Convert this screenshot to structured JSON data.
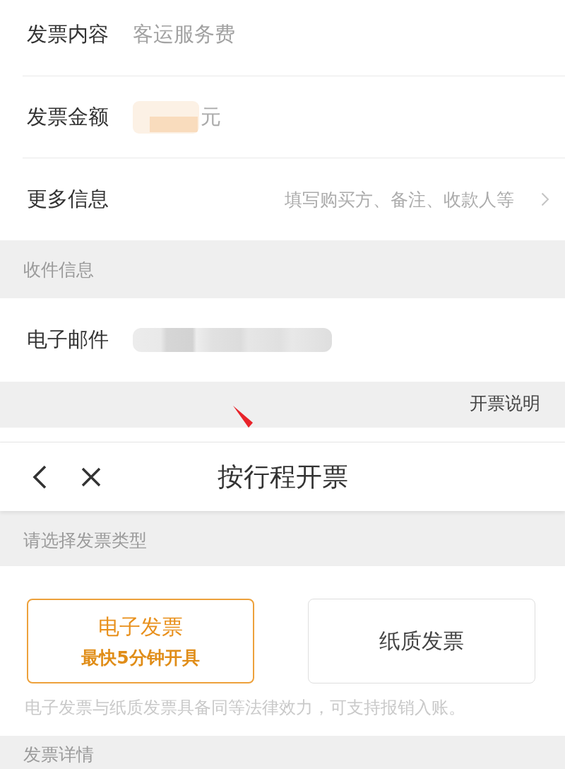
{
  "invoice_form": {
    "rows": [
      {
        "kind": "text",
        "label": "发票内容",
        "value": "客运服务费"
      },
      {
        "kind": "amount",
        "label": "发票金额",
        "unit": "元"
      },
      {
        "kind": "link",
        "label": "更多信息",
        "hint": "填写购买方、备注、收款人等"
      }
    ]
  },
  "recipient_section": {
    "title": "收件信息",
    "rows": [
      {
        "kind": "email",
        "label": "电子邮件"
      }
    ]
  },
  "invoice_notes_link": "开票说明",
  "nav_bar": {
    "title": "按行程开票"
  },
  "type_section": {
    "title": "请选择发票类型",
    "options": [
      {
        "title": "电子发票",
        "subtitle": "最快5分钟开具",
        "selected": true
      },
      {
        "title": "纸质发票",
        "selected": false
      }
    ],
    "note": "电子发票与纸质发票具备同等法律效力，可支持报销入账。"
  },
  "details_section": {
    "title": "发票详情"
  }
}
